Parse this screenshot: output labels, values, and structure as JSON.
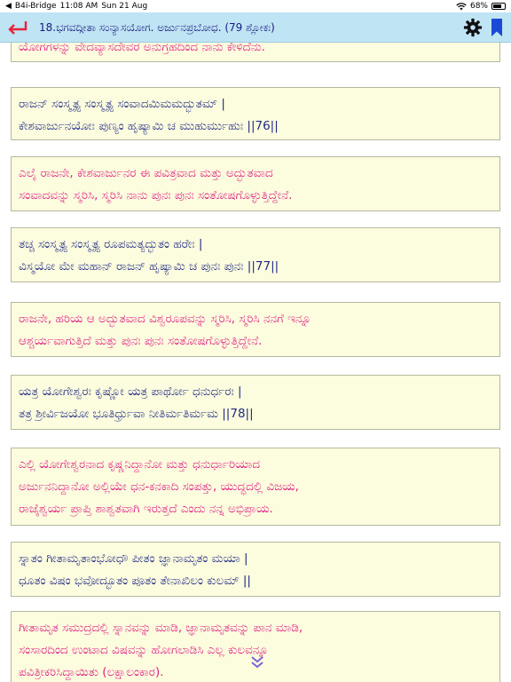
{
  "status": {
    "back_app": "B4i-Bridge",
    "time": "11:08 AM",
    "date": "Sun 21 Aug",
    "battery": "68%"
  },
  "header": {
    "title": "18.ಭಗವದ್ಗೀತಾ ಸಂನ್ಯಾಸಯೋಗ. ಅರ್ಜುನಪ್ರಬೋಧ. (79 ಶ್ಲೋಕಃ)"
  },
  "colors": {
    "header_bg": "#bfe4f3",
    "verse_bg": "#fcfcde",
    "sanskrit_text": "#1f2a86",
    "kannada_text": "#e01f86",
    "back_arrow": "#e8223a",
    "bookmark": "#1a49d6"
  },
  "icons": {
    "back": "back-arrow-icon",
    "settings": "gear-icon",
    "bookmark": "bookmark-icon",
    "more": "double-chevron-down-icon"
  },
  "verses": [
    {
      "type": "kannada",
      "lines": [
        "ಯೋಗಗಳನ್ನು ವೇದವ್ಯಾಸದೇವರ ಅನುಗ್ರಹದಿಂದ ನಾನು ಕೇಳಿದೆನು."
      ]
    },
    {
      "type": "sanskrit",
      "lines": [
        "ರಾಜನ್ ಸಂಸ್ಮೃತ್ಯ ಸಂಸ್ಮೃತ್ಯ ಸಂವಾದಮಿಮಮದ್ಭುತಮ್ |",
        "ಕೇಶವಾರ್ಜುನಯೋಃ ಪುಣ್ಯಂ ಹೃಷ್ಯಾಮಿ ಚ ಮುಹುರ್ಮುಹುಃ ||76||"
      ]
    },
    {
      "type": "kannada",
      "lines": [
        "ಎಲೈ ರಾಜನೇ, ಕೇಶವಾರ್ಜುನರ ಈ ಪವಿತ್ರವಾದ ಮತ್ತು ಅದ್ಭುತವಾದ",
        "ಸಂವಾದವನ್ನು ಸ್ಮರಿಸಿ, ಸ್ಮರಿಸಿ ನಾನು ಪುನಃ ಪುನಃ ಸಂತೋಷಗೊಳ್ಳುತ್ತಿದ್ದೇನೆ."
      ]
    },
    {
      "type": "sanskrit",
      "lines": [
        "ತಚ್ಚ ಸಂಸ್ಮೃತ್ಯ ಸಂಸ್ಮೃತ್ಯ ರೂಪಮತ್ಯದ್ಭುತಂ ಹರೇಃ |",
        "ವಿಸ್ಮಯೋ ಮೇ ಮಹಾನ್ ರಾಜನ್ ಹೃಷ್ಯಾಮಿ ಚ ಪುನಃ ಪುನಃ ||77||"
      ]
    },
    {
      "type": "kannada",
      "lines": [
        "ರಾಜನೇ, ಹರಿಯ ಆ ಅದ್ಭುತವಾದ ವಿಶ್ವರೂಪವನ್ನು ಸ್ಮರಿಸಿ, ಸ್ಮರಿಸಿ ನನಗೆ ಇನ್ನೂ",
        "ಆಶ್ಚರ್ಯವಾಗುತ್ತಿದೆ ಮತ್ತು ಪುನಃ ಪುನಃ ಸಂತೋಷಗೊಳ್ಳುತ್ತಿದ್ದೇನೆ."
      ]
    },
    {
      "type": "sanskrit",
      "lines": [
        "ಯತ್ರ ಯೋಗೇಶ್ವರಃ ಕೃಷ್ಣೋ ಯತ್ರ ಪಾರ್ಥೋ ಧನುರ್ಧರಃ |",
        "ತತ್ರ ಶ್ರೀರ್ವಿಜಯೋ ಭೂತಿರ್ಧ್ರುವಾ ನೀತಿರ್ಮತಿರ್ಮಮ ||78||"
      ]
    },
    {
      "type": "kannada",
      "lines": [
        "ಎಲ್ಲಿ ಯೋಗೇಶ್ವರನಾದ ಕೃಷ್ಣನಿದ್ದಾನೋ ಮತ್ತು ಧನುರ್ಧಾರಿಯಾದ",
        "ಅರ್ಜುನನಿದ್ದಾನೋ ಅಲ್ಲಿಯೇ ಧನ-ಕನಕಾದಿ ಸಂಪತ್ತು, ಯುದ್ಧದಲ್ಲಿ ವಿಜಯ,",
        "ರಾಜೈಶ್ವರ್ಯ ಪ್ರಾಪ್ತಿ ಶಾಶ್ವತವಾಗಿ ಇರುತ್ತದೆ ಎಂದು ನನ್ನ ಅಭಿಪ್ರಾಯ."
      ]
    },
    {
      "type": "sanskrit",
      "lines": [
        "ಸ್ನಾತಂ ಗೀತಾಮೃತಾಂಭೋಧೌ ಪೀತಂ ಜ್ಞಾನಾಮೃತಂ ಮಯಾ |",
        "ಧೂತಂ ವಿಷಂ ಭವೋದ್ಭೂತಂ ಪೂತಂ ತೇನಾಖಿಲಂ ಕುಲಮ್ ||"
      ]
    },
    {
      "type": "kannada",
      "lines": [
        "ಗೀತಾಮೃತ ಸಮುದ್ರದಲ್ಲಿ ಸ್ನಾನವನ್ನು ಮಾಡಿ, ಜ್ಞಾನಾಮೃತವನ್ನು ಪಾನ ಮಾಡಿ,",
        "ಸಂಸಾರದಿಂದ ಉಂಟಾದ ವಿಷವನ್ನು ಹೋಗಲಾಡಿಸಿ ಎಲ್ಲ ಕುಲವನ್ನೂ",
        "ಪವಿತ್ರೀಕರಿಸಿದ್ದಾಯಿತು (ಲಕ್ಷಾಲಂಕಾರ)."
      ]
    }
  ]
}
